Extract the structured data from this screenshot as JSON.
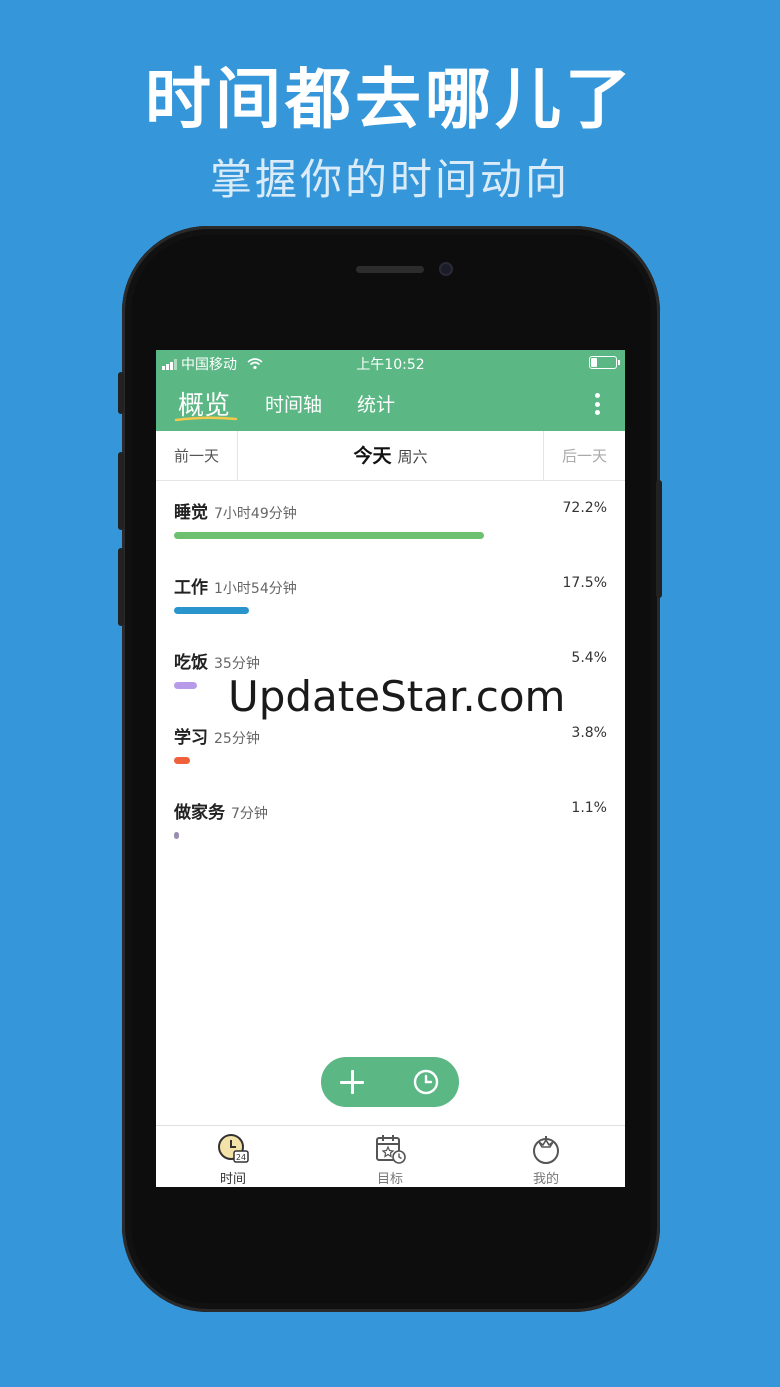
{
  "promo": {
    "headline": "时间都去哪儿了",
    "subline": "掌握你的时间动向"
  },
  "status_bar": {
    "carrier": "中国移动",
    "time": "上午10:52"
  },
  "top_tabs": {
    "overview": "概览",
    "timeline": "时间轴",
    "stats": "统计"
  },
  "day_nav": {
    "prev": "前一天",
    "today": "今天",
    "weekday": "周六",
    "next": "后一天"
  },
  "activities": [
    {
      "name": "睡觉",
      "duration": "7小时49分钟",
      "percent_label": "72.2%",
      "percent": 72.2,
      "color": "#6CC070"
    },
    {
      "name": "工作",
      "duration": "1小时54分钟",
      "percent_label": "17.5%",
      "percent": 17.5,
      "color": "#2A95CD"
    },
    {
      "name": "吃饭",
      "duration": "35分钟",
      "percent_label": "5.4%",
      "percent": 5.4,
      "color": "#B79BE8"
    },
    {
      "name": "学习",
      "duration": "25分钟",
      "percent_label": "3.8%",
      "percent": 3.8,
      "color": "#F0603A"
    },
    {
      "name": "做家务",
      "duration": "7分钟",
      "percent_label": "1.1%",
      "percent": 1.1,
      "color": "#9A8FB0"
    }
  ],
  "watermark": "UpdateStar.com",
  "bottom_tabs": {
    "time": "时间",
    "goals": "目标",
    "me": "我的"
  },
  "colors": {
    "background": "#3597DA",
    "brand_green": "#5BB784"
  }
}
